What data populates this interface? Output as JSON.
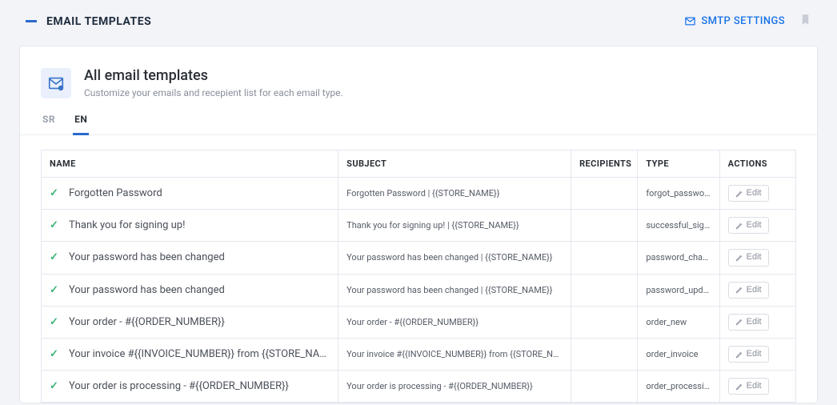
{
  "header": {
    "title": "EMAIL TEMPLATES",
    "smtp_link": "SMTP SETTINGS"
  },
  "card": {
    "title": "All email templates",
    "subtitle": "Customize your emails and recepient list for each email type."
  },
  "lang_tabs": {
    "tabs": [
      {
        "code": "SR",
        "active": false
      },
      {
        "code": "EN",
        "active": true
      }
    ]
  },
  "columns": {
    "name": "NAME",
    "subject": "SUBJECT",
    "recipients": "RECIPIENTS",
    "type": "TYPE",
    "actions": "ACTIONS"
  },
  "edit_label": "Edit",
  "rows": [
    {
      "name": "Forgotten Password",
      "subject": "Forgotten Password | {{STORE_NAME}}",
      "recipients": "",
      "type": "forgot_password"
    },
    {
      "name": "Thank you for signing up!",
      "subject": "Thank you for signing up! | {{STORE_NAME}}",
      "recipients": "",
      "type": "successful_sign_up"
    },
    {
      "name": "Your password has been changed",
      "subject": "Your password has been changed | {{STORE_NAME}}",
      "recipients": "",
      "type": "password_changed"
    },
    {
      "name": "Your password has been changed",
      "subject": "Your password has been changed | {{STORE_NAME}}",
      "recipients": "",
      "type": "password_updated"
    },
    {
      "name": "Your order - #{{ORDER_NUMBER}}",
      "subject": "Your order - #{{ORDER_NUMBER}}",
      "recipients": "",
      "type": "order_new"
    },
    {
      "name": "Your invoice #{{INVOICE_NUMBER}} from {{STORE_NAME}}",
      "subject": "Your invoice #{{INVOICE_NUMBER}} from {{STORE_NAME}}",
      "recipients": "",
      "type": "order_invoice"
    },
    {
      "name": "Your order is processing - #{{ORDER_NUMBER}}",
      "subject": "Your order is processing - #{{ORDER_NUMBER}}",
      "recipients": "",
      "type": "order_processing"
    }
  ]
}
